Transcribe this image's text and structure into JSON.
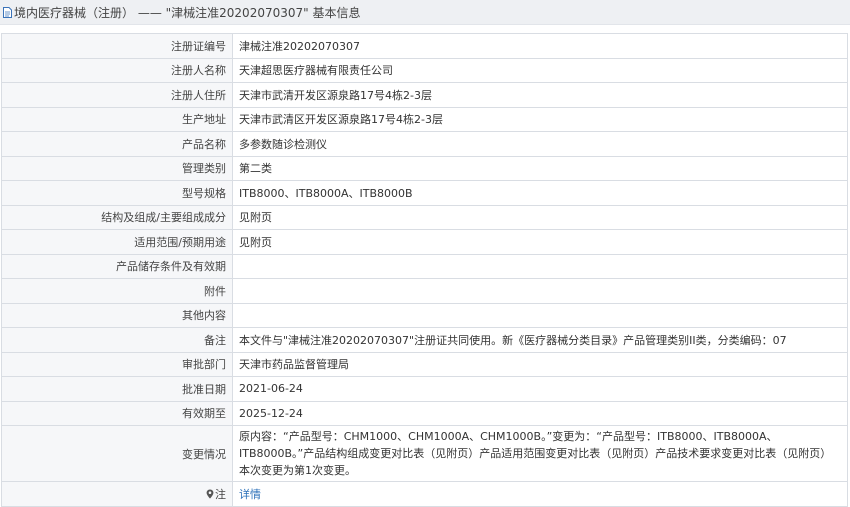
{
  "header": {
    "title": "境内医疗器械（注册）  ——  \"津械注准20202070307\"  基本信息"
  },
  "rows": [
    {
      "label": "注册证编号",
      "value": "津械注准20202070307"
    },
    {
      "label": "注册人名称",
      "value": "天津超思医疗器械有限责任公司"
    },
    {
      "label": "注册人住所",
      "value": "天津市武清开发区源泉路17号4栋2-3层"
    },
    {
      "label": "生产地址",
      "value": "天津市武清区开发区源泉路17号4栋2-3层"
    },
    {
      "label": "产品名称",
      "value": "多参数随诊检测仪"
    },
    {
      "label": "管理类别",
      "value": "第二类"
    },
    {
      "label": "型号规格",
      "value": "ITB8000、ITB8000A、ITB8000B"
    },
    {
      "label": "结构及组成/主要组成成分",
      "value": "见附页"
    },
    {
      "label": "适用范围/预期用途",
      "value": "见附页"
    },
    {
      "label": "产品储存条件及有效期",
      "value": ""
    },
    {
      "label": "附件",
      "value": ""
    },
    {
      "label": "其他内容",
      "value": ""
    },
    {
      "label": "备注",
      "value": "本文件与\"津械注准20202070307\"注册证共同使用。新《医疗器械分类目录》产品管理类别II类，分类编码：07"
    },
    {
      "label": "审批部门",
      "value": "天津市药品监督管理局"
    },
    {
      "label": "批准日期",
      "value": "2021-06-24"
    },
    {
      "label": "有效期至",
      "value": "2025-12-24"
    },
    {
      "label": "变更情况",
      "value": "原内容：“产品型号：CHM1000、CHM1000A、CHM1000B。”变更为：“产品型号：ITB8000、ITB8000A、ITB8000B。”产品结构组成变更对比表（见附页）产品适用范围变更对比表（见附页）产品技术要求变更对比表（见附页）本次变更为第1次变更。"
    }
  ],
  "note": {
    "label": "注",
    "link": "详情"
  }
}
